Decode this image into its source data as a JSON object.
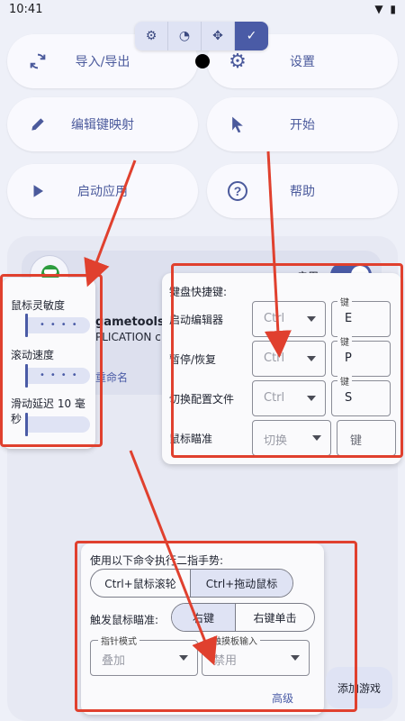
{
  "status": {
    "time": "10:41",
    "icons": "▼ ▮"
  },
  "toolbar_segments": [
    {
      "icon": "gear-icon",
      "glyph": "⚙"
    },
    {
      "icon": "gauge-icon",
      "glyph": "◔"
    },
    {
      "icon": "dpad-icon",
      "glyph": "✥"
    },
    {
      "icon": "check-icon",
      "glyph": "✓"
    }
  ],
  "buttons": {
    "import_export": "导入/导出",
    "settings": "设置",
    "edit_keymap": "编辑键映射",
    "start": "开始",
    "launch_app": "启动应用",
    "help": "帮助"
  },
  "profile": {
    "enable_label": "启用",
    "name": "gametools",
    "package": "PLICATION c",
    "rename": "重命名"
  },
  "mouse_panel": {
    "sensitivity": "鼠标灵敏度",
    "scroll_speed": "滚动速度",
    "slide_delay": "滑动延迟 10 毫秒"
  },
  "key_panel": {
    "title": "键盘快捷键:",
    "key_caption": "键",
    "rows": [
      {
        "name": "启动编辑器",
        "mod": "Ctrl",
        "key": "E"
      },
      {
        "name": "暂停/恢复",
        "mod": "Ctrl",
        "key": "P"
      },
      {
        "name": "切换配置文件",
        "mod": "Ctrl",
        "key": "S"
      }
    ],
    "aim": {
      "name": "鼠标瞄准",
      "mode": "切换",
      "key": "键"
    }
  },
  "gesture_panel": {
    "title": "使用以下命令执行二指手势:",
    "opt1": "Ctrl+鼠标滚轮",
    "opt2": "Ctrl+拖动鼠标",
    "trigger_label": "触发鼠标瞄准:",
    "trigger1": "右键",
    "trigger2": "右键单击",
    "pointer_mode_caption": "指针模式",
    "pointer_mode_value": "叠加",
    "touchpad_caption": "触摸板输入",
    "touchpad_value": "禁用",
    "advanced": "高级"
  },
  "add_game": "添加游戏",
  "colors": {
    "accent": "#4a5ba6",
    "annotation": "#e0402e"
  }
}
